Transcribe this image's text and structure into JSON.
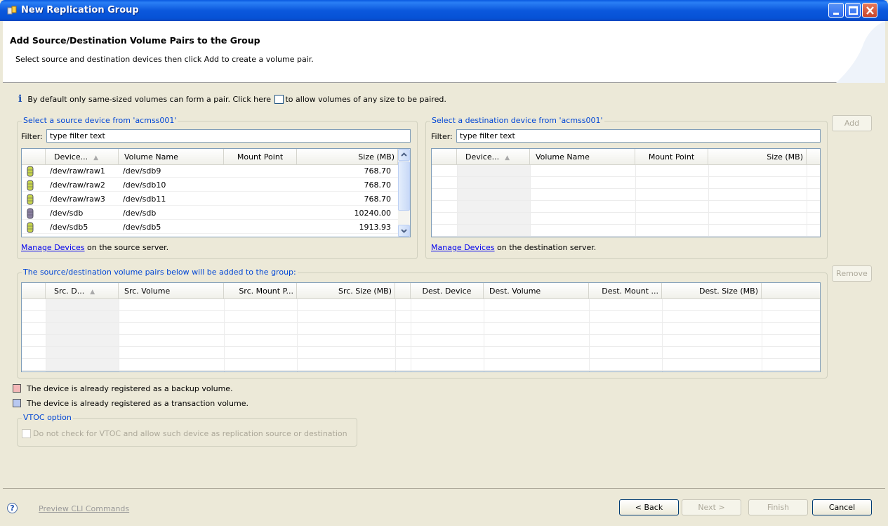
{
  "window": {
    "title": "New Replication Group"
  },
  "banner": {
    "title": "Add Source/Destination Volume Pairs to the Group",
    "subtitle": "Select source and destination devices then click Add to create a volume pair."
  },
  "info": {
    "text_before": "By default only same-sized volumes can form a pair. Click here",
    "text_after": "to allow volumes of any size to be paired."
  },
  "source": {
    "legend": "Select a source device from 'acmss001'",
    "filter_label": "Filter:",
    "filter_value": "type filter text",
    "columns": [
      "Device...",
      "Volume Name",
      "Mount Point",
      "Size (MB)"
    ],
    "rows": [
      {
        "device": "/dev/raw/raw1",
        "volume": "/dev/sdb9",
        "mount": "",
        "size": "768.70",
        "icon_color": "#c8d64a"
      },
      {
        "device": "/dev/raw/raw2",
        "volume": "/dev/sdb10",
        "mount": "",
        "size": "768.70",
        "icon_color": "#c8d64a"
      },
      {
        "device": "/dev/raw/raw3",
        "volume": "/dev/sdb11",
        "mount": "",
        "size": "768.70",
        "icon_color": "#c8d64a"
      },
      {
        "device": "/dev/sdb",
        "volume": "/dev/sdb",
        "mount": "",
        "size": "10240.00",
        "icon_color": "#8a7fa0"
      },
      {
        "device": "/dev/sdb5",
        "volume": "/dev/sdb5",
        "mount": "",
        "size": "1913.93",
        "icon_color": "#c8d64a"
      }
    ],
    "manage_link": "Manage Devices",
    "manage_suffix": "on the source server."
  },
  "destination": {
    "legend": "Select a destination device from 'acmss001'",
    "filter_label": "Filter:",
    "filter_value": "type filter text",
    "columns": [
      "Device...",
      "Volume Name",
      "Mount Point",
      "Size (MB)"
    ],
    "manage_link": "Manage Devices",
    "manage_suffix": "on the destination server."
  },
  "pairs": {
    "legend": "The source/destination volume pairs below will be added to the group:",
    "columns": [
      "Src. D...",
      "Src. Volume",
      "Src. Mount P...",
      "Src. Size (MB)",
      "Dest. Device",
      "Dest. Volume",
      "Dest. Mount ...",
      "Dest. Size (MB)"
    ]
  },
  "buttons": {
    "add": "Add",
    "remove": "Remove",
    "back": "< Back",
    "next": "Next >",
    "finish": "Finish",
    "cancel": "Cancel"
  },
  "legend_items": {
    "backup": "The device is already registered as a backup volume.",
    "backup_color": "#f4b8b8",
    "transaction": "The device is already registered as a transaction volume.",
    "transaction_color": "#b8c8f0"
  },
  "vtoc": {
    "legend": "VTOC option",
    "label": "Do not check for VTOC and allow such device as replication source or destination"
  },
  "footer": {
    "preview": "Preview CLI Commands"
  }
}
